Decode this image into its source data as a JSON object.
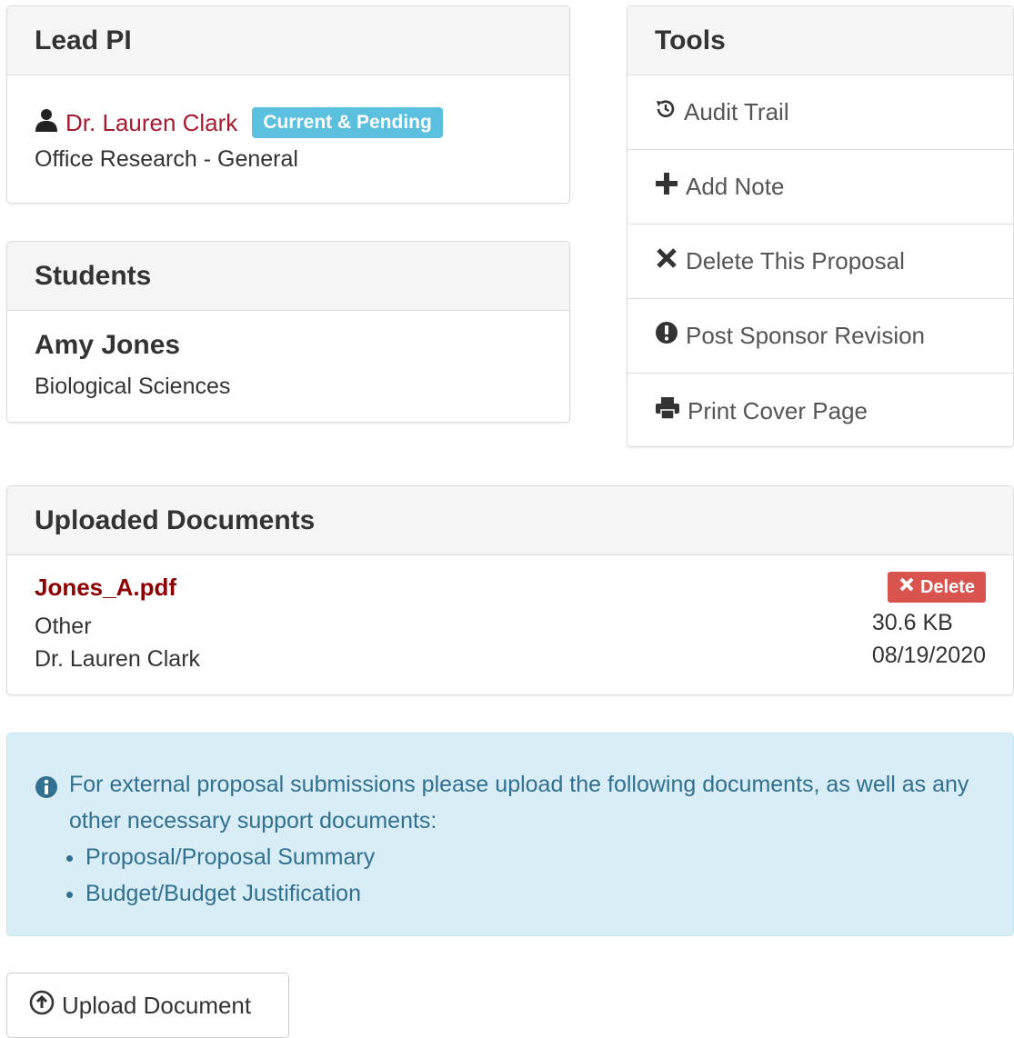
{
  "lead_pi": {
    "heading": "Lead PI",
    "name": "Dr. Lauren Clark",
    "badge": "Current & Pending",
    "department": "Office Research - General"
  },
  "students": {
    "heading": "Students",
    "items": [
      {
        "name": "Amy Jones",
        "department": "Biological Sciences"
      }
    ]
  },
  "tools": {
    "heading": "Tools",
    "items": [
      {
        "label": "Audit Trail",
        "icon": "history-icon"
      },
      {
        "label": "Add Note",
        "icon": "plus-icon"
      },
      {
        "label": "Delete This Proposal",
        "icon": "times-icon"
      },
      {
        "label": "Post Sponsor Revision",
        "icon": "exclamation-circle-icon"
      },
      {
        "label": "Print Cover Page",
        "icon": "print-icon"
      }
    ]
  },
  "documents": {
    "heading": "Uploaded Documents",
    "items": [
      {
        "filename": "Jones_A.pdf",
        "type": "Other",
        "uploader": "Dr. Lauren Clark",
        "delete_label": "Delete",
        "size": "30.6 KB",
        "date": "08/19/2020"
      }
    ]
  },
  "alert": {
    "text": "For external proposal submissions please upload the following documents, as well as any other necessary support documents:",
    "items": [
      "Proposal/Proposal Summary",
      "Budget/Budget Justification"
    ]
  },
  "upload_button": {
    "label": "Upload Document"
  },
  "colors": {
    "link_red": "#a51c30",
    "badge_info": "#5bc0de",
    "danger": "#d9534f",
    "alert_bg": "#d9edf7",
    "alert_text": "#31708f"
  }
}
